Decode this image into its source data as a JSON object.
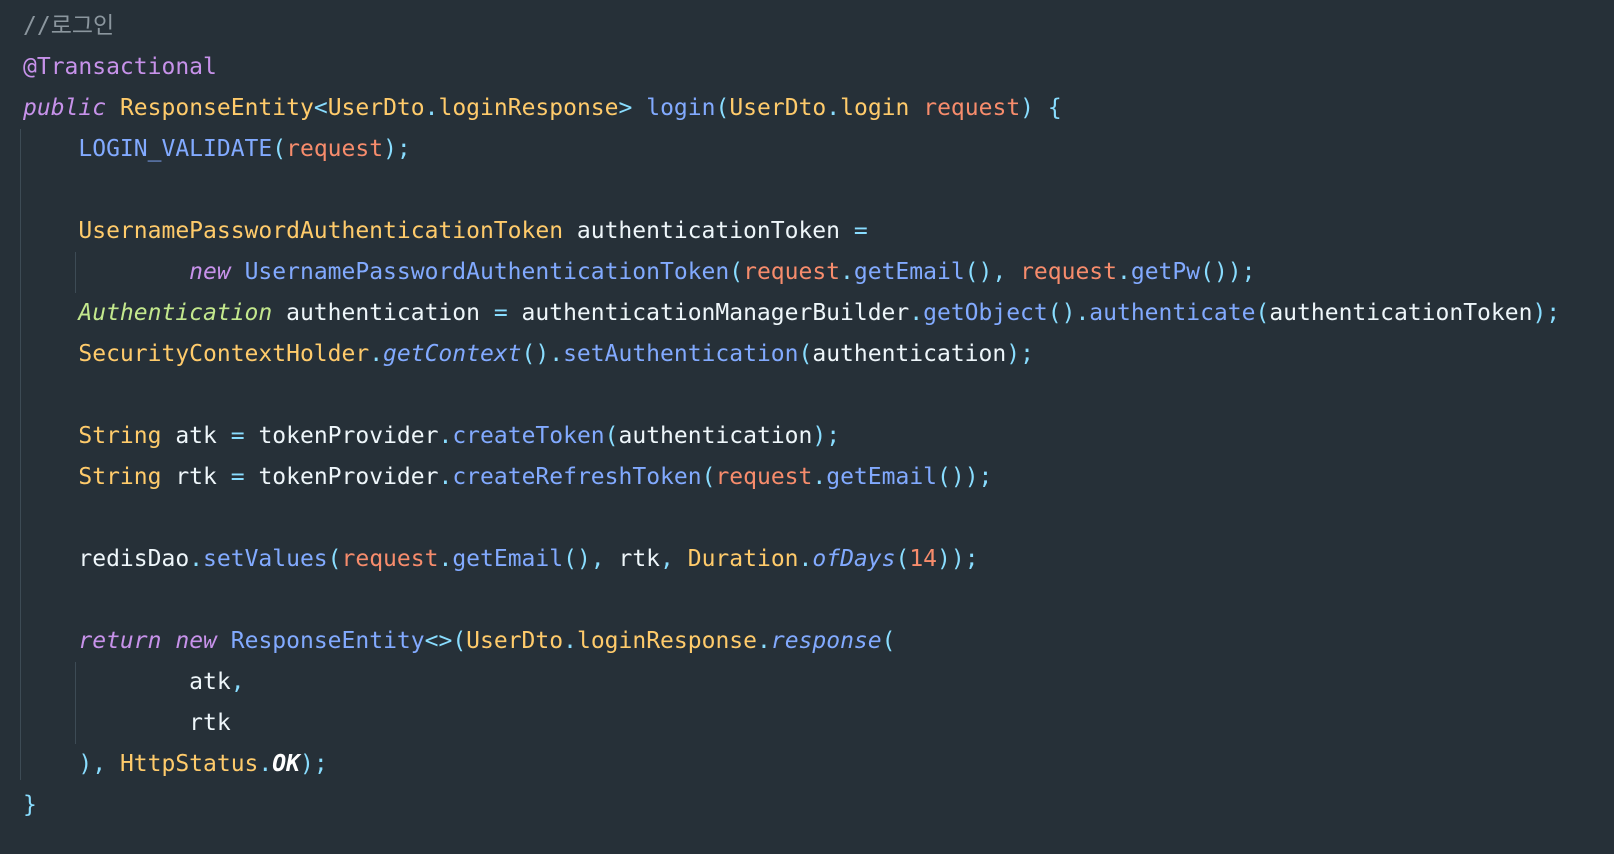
{
  "editor": {
    "background": "#263038",
    "colors": {
      "comment": "#8b969e",
      "annotation": "#c792ea",
      "keyword": "#c792ea",
      "type": "#ffcb6b",
      "function": "#82aaff",
      "parameter": "#f78c6c",
      "punctuation": "#89ddff",
      "identifier": "#eef6fa"
    },
    "lines": [
      {
        "tokens": [
          {
            "t": "//로그인",
            "c": "cm"
          }
        ]
      },
      {
        "tokens": [
          {
            "t": "@Transactional",
            "c": "an"
          }
        ]
      },
      {
        "tokens": [
          {
            "t": "public",
            "c": "kw"
          },
          {
            "t": " ",
            "c": "id"
          },
          {
            "t": "ResponseEntity",
            "c": "ty"
          },
          {
            "t": "<",
            "c": "pu"
          },
          {
            "t": "UserDto",
            "c": "ty"
          },
          {
            "t": ".",
            "c": "pu"
          },
          {
            "t": "loginResponse",
            "c": "ty"
          },
          {
            "t": ">",
            "c": "pu"
          },
          {
            "t": " ",
            "c": "id"
          },
          {
            "t": "login",
            "c": "fn"
          },
          {
            "t": "(",
            "c": "pu"
          },
          {
            "t": "UserDto",
            "c": "ty"
          },
          {
            "t": ".",
            "c": "pu"
          },
          {
            "t": "login",
            "c": "ty"
          },
          {
            "t": " ",
            "c": "id"
          },
          {
            "t": "request",
            "c": "pa"
          },
          {
            "t": ") {",
            "c": "pu"
          }
        ]
      },
      {
        "tokens": [
          {
            "t": "    ",
            "c": "id"
          },
          {
            "t": "LOGIN_VALIDATE",
            "c": "fn"
          },
          {
            "t": "(",
            "c": "pu"
          },
          {
            "t": "request",
            "c": "pa"
          },
          {
            "t": ");",
            "c": "pu"
          }
        ]
      },
      {
        "tokens": []
      },
      {
        "tokens": [
          {
            "t": "    ",
            "c": "id"
          },
          {
            "t": "UsernamePasswordAuthenticationToken",
            "c": "ty"
          },
          {
            "t": " authenticationToken ",
            "c": "id"
          },
          {
            "t": "=",
            "c": "pu"
          }
        ]
      },
      {
        "tokens": [
          {
            "t": "            ",
            "c": "id"
          },
          {
            "t": "new",
            "c": "kw"
          },
          {
            "t": " ",
            "c": "id"
          },
          {
            "t": "UsernamePasswordAuthenticationToken",
            "c": "fn"
          },
          {
            "t": "(",
            "c": "pu"
          },
          {
            "t": "request",
            "c": "pa"
          },
          {
            "t": ".",
            "c": "pu"
          },
          {
            "t": "getEmail",
            "c": "fn"
          },
          {
            "t": "(), ",
            "c": "pu"
          },
          {
            "t": "request",
            "c": "pa"
          },
          {
            "t": ".",
            "c": "pu"
          },
          {
            "t": "getPw",
            "c": "fn"
          },
          {
            "t": "());",
            "c": "pu"
          }
        ]
      },
      {
        "tokens": [
          {
            "t": "    ",
            "c": "id"
          },
          {
            "t": "Authentication",
            "c": "tyi"
          },
          {
            "t": " authentication ",
            "c": "id"
          },
          {
            "t": "=",
            "c": "pu"
          },
          {
            "t": " authenticationManagerBuilder",
            "c": "id"
          },
          {
            "t": ".",
            "c": "pu"
          },
          {
            "t": "getObject",
            "c": "fn"
          },
          {
            "t": "().",
            "c": "pu"
          },
          {
            "t": "authenticate",
            "c": "fn"
          },
          {
            "t": "(",
            "c": "pu"
          },
          {
            "t": "authenticationToken",
            "c": "id"
          },
          {
            "t": ");",
            "c": "pu"
          }
        ]
      },
      {
        "tokens": [
          {
            "t": "    ",
            "c": "id"
          },
          {
            "t": "SecurityContextHolder",
            "c": "ty"
          },
          {
            "t": ".",
            "c": "pu"
          },
          {
            "t": "getContext",
            "c": "fni"
          },
          {
            "t": "().",
            "c": "pu"
          },
          {
            "t": "setAuthentication",
            "c": "fn"
          },
          {
            "t": "(",
            "c": "pu"
          },
          {
            "t": "authentication",
            "c": "id"
          },
          {
            "t": ");",
            "c": "pu"
          }
        ]
      },
      {
        "tokens": []
      },
      {
        "tokens": [
          {
            "t": "    ",
            "c": "id"
          },
          {
            "t": "String",
            "c": "ty"
          },
          {
            "t": " atk ",
            "c": "id"
          },
          {
            "t": "=",
            "c": "pu"
          },
          {
            "t": " tokenProvider",
            "c": "id"
          },
          {
            "t": ".",
            "c": "pu"
          },
          {
            "t": "createToken",
            "c": "fn"
          },
          {
            "t": "(",
            "c": "pu"
          },
          {
            "t": "authentication",
            "c": "id"
          },
          {
            "t": ");",
            "c": "pu"
          }
        ]
      },
      {
        "tokens": [
          {
            "t": "    ",
            "c": "id"
          },
          {
            "t": "String",
            "c": "ty"
          },
          {
            "t": " rtk ",
            "c": "id"
          },
          {
            "t": "=",
            "c": "pu"
          },
          {
            "t": " tokenProvider",
            "c": "id"
          },
          {
            "t": ".",
            "c": "pu"
          },
          {
            "t": "createRefreshToken",
            "c": "fn"
          },
          {
            "t": "(",
            "c": "pu"
          },
          {
            "t": "request",
            "c": "pa"
          },
          {
            "t": ".",
            "c": "pu"
          },
          {
            "t": "getEmail",
            "c": "fn"
          },
          {
            "t": "());",
            "c": "pu"
          }
        ]
      },
      {
        "tokens": []
      },
      {
        "tokens": [
          {
            "t": "    ",
            "c": "id"
          },
          {
            "t": "redisDao",
            "c": "id"
          },
          {
            "t": ".",
            "c": "pu"
          },
          {
            "t": "setValues",
            "c": "fn"
          },
          {
            "t": "(",
            "c": "pu"
          },
          {
            "t": "request",
            "c": "pa"
          },
          {
            "t": ".",
            "c": "pu"
          },
          {
            "t": "getEmail",
            "c": "fn"
          },
          {
            "t": "(), ",
            "c": "pu"
          },
          {
            "t": "rtk",
            "c": "id"
          },
          {
            "t": ", ",
            "c": "pu"
          },
          {
            "t": "Duration",
            "c": "ty"
          },
          {
            "t": ".",
            "c": "pu"
          },
          {
            "t": "ofDays",
            "c": "fni"
          },
          {
            "t": "(",
            "c": "pu"
          },
          {
            "t": "14",
            "c": "nu"
          },
          {
            "t": "));",
            "c": "pu"
          }
        ]
      },
      {
        "tokens": []
      },
      {
        "tokens": [
          {
            "t": "    ",
            "c": "id"
          },
          {
            "t": "return",
            "c": "kw"
          },
          {
            "t": " ",
            "c": "id"
          },
          {
            "t": "new",
            "c": "kw"
          },
          {
            "t": " ",
            "c": "id"
          },
          {
            "t": "ResponseEntity",
            "c": "fn"
          },
          {
            "t": "<>(",
            "c": "pu"
          },
          {
            "t": "UserDto",
            "c": "ty"
          },
          {
            "t": ".",
            "c": "pu"
          },
          {
            "t": "loginResponse",
            "c": "ty"
          },
          {
            "t": ".",
            "c": "pu"
          },
          {
            "t": "response",
            "c": "fni"
          },
          {
            "t": "(",
            "c": "pu"
          }
        ]
      },
      {
        "tokens": [
          {
            "t": "            ",
            "c": "id"
          },
          {
            "t": "atk",
            "c": "id"
          },
          {
            "t": ",",
            "c": "pu"
          }
        ]
      },
      {
        "tokens": [
          {
            "t": "            ",
            "c": "id"
          },
          {
            "t": "rtk",
            "c": "id"
          }
        ]
      },
      {
        "tokens": [
          {
            "t": "    ",
            "c": "id"
          },
          {
            "t": "), ",
            "c": "pu"
          },
          {
            "t": "HttpStatus",
            "c": "ty"
          },
          {
            "t": ".",
            "c": "pu"
          },
          {
            "t": "OK",
            "c": "cn"
          },
          {
            "t": ");",
            "c": "pu"
          }
        ]
      },
      {
        "tokens": [
          {
            "t": "}",
            "c": "pu"
          }
        ]
      }
    ]
  }
}
